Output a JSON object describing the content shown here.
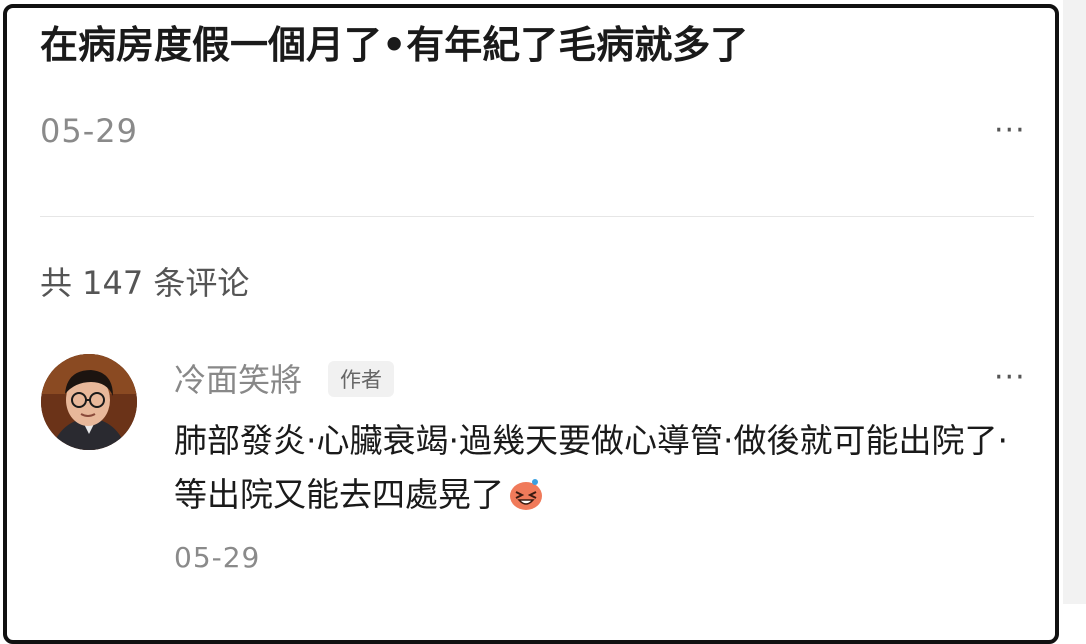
{
  "post": {
    "title": "在病房度假一個月了•有年紀了毛病就多了",
    "date": "05-29",
    "more_label": "···"
  },
  "comments_header": {
    "count_text": "共 147 条评论"
  },
  "comment": {
    "author": "冷面笑將",
    "badge": "作者",
    "text": "肺部發炎·心臟衰竭·過幾天要做心導管·做後就可能出院了·等出院又能去四處晃了",
    "emoji": "laughing-face-icon",
    "date": "05-29",
    "more_label": "···"
  },
  "colors": {
    "frame": "#111111",
    "title_text": "#1a1a1a",
    "muted_text": "#8a8a8a",
    "badge_bg": "#f1f1f1",
    "emoji": "#f07a5a"
  }
}
